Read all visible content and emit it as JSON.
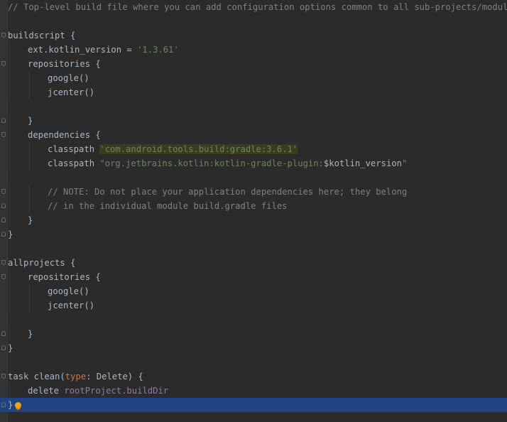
{
  "editor": {
    "language": "gradle",
    "lines": [
      {
        "indent": 0,
        "fold": "",
        "parts": [
          {
            "t": "// Top-level build file where you can add configuration options common to all sub-projects/modules.",
            "c": "c"
          }
        ]
      },
      {
        "indent": 0,
        "fold": "",
        "parts": []
      },
      {
        "indent": 0,
        "fold": "start",
        "parts": [
          {
            "t": "buildscript {",
            "c": ""
          }
        ]
      },
      {
        "indent": 1,
        "fold": "",
        "parts": [
          {
            "t": "ext.kotlin_version = ",
            "c": ""
          },
          {
            "t": "'1.3.61'",
            "c": "s"
          }
        ]
      },
      {
        "indent": 1,
        "fold": "start",
        "parts": [
          {
            "t": "repositories {",
            "c": ""
          }
        ]
      },
      {
        "indent": 2,
        "fold": "",
        "parts": [
          {
            "t": "google()",
            "c": ""
          }
        ]
      },
      {
        "indent": 2,
        "fold": "",
        "parts": [
          {
            "t": "jcenter()",
            "c": ""
          }
        ]
      },
      {
        "indent": 0,
        "fold": "",
        "parts": []
      },
      {
        "indent": 1,
        "fold": "end",
        "parts": [
          {
            "t": "}",
            "c": ""
          }
        ]
      },
      {
        "indent": 1,
        "fold": "start",
        "parts": [
          {
            "t": "dependencies {",
            "c": ""
          }
        ]
      },
      {
        "indent": 2,
        "fold": "",
        "parts": [
          {
            "t": "classpath ",
            "c": ""
          },
          {
            "t": "'com.android.tools.build:gradle:3.6.1'",
            "c": "s hl"
          }
        ]
      },
      {
        "indent": 2,
        "fold": "",
        "parts": [
          {
            "t": "classpath ",
            "c": ""
          },
          {
            "t": "\"org.jetbrains.kotlin:kotlin-gradle-plugin:",
            "c": "s"
          },
          {
            "t": "$kotlin_version",
            "c": ""
          },
          {
            "t": "\"",
            "c": "s"
          }
        ]
      },
      {
        "indent": 0,
        "fold": "",
        "parts": []
      },
      {
        "indent": 2,
        "fold": "start",
        "parts": [
          {
            "t": "// NOTE: Do not place your application dependencies here; they belong",
            "c": "c"
          }
        ]
      },
      {
        "indent": 2,
        "fold": "end",
        "parts": [
          {
            "t": "// in the individual module build.gradle files",
            "c": "c"
          }
        ]
      },
      {
        "indent": 1,
        "fold": "end",
        "parts": [
          {
            "t": "}",
            "c": ""
          }
        ]
      },
      {
        "indent": 0,
        "fold": "end",
        "parts": [
          {
            "t": "}",
            "c": ""
          }
        ]
      },
      {
        "indent": 0,
        "fold": "",
        "parts": []
      },
      {
        "indent": 0,
        "fold": "start",
        "parts": [
          {
            "t": "allprojects {",
            "c": ""
          }
        ]
      },
      {
        "indent": 1,
        "fold": "start",
        "parts": [
          {
            "t": "repositories {",
            "c": ""
          }
        ]
      },
      {
        "indent": 2,
        "fold": "",
        "parts": [
          {
            "t": "google()",
            "c": ""
          }
        ]
      },
      {
        "indent": 2,
        "fold": "",
        "parts": [
          {
            "t": "jcenter()",
            "c": ""
          }
        ]
      },
      {
        "indent": 0,
        "fold": "",
        "parts": []
      },
      {
        "indent": 1,
        "fold": "end",
        "parts": [
          {
            "t": "}",
            "c": ""
          }
        ]
      },
      {
        "indent": 0,
        "fold": "end",
        "parts": [
          {
            "t": "}",
            "c": ""
          }
        ]
      },
      {
        "indent": 0,
        "fold": "",
        "parts": []
      },
      {
        "indent": 0,
        "fold": "start",
        "parts": [
          {
            "t": "task clean(",
            "c": ""
          },
          {
            "t": "type",
            "c": "k"
          },
          {
            "t": ": Delete) {",
            "c": ""
          }
        ]
      },
      {
        "indent": 1,
        "fold": "",
        "parts": [
          {
            "t": "delete ",
            "c": ""
          },
          {
            "t": "rootProject",
            "c": "p"
          },
          {
            "t": ".buildDir",
            "c": "p"
          }
        ]
      },
      {
        "indent": 0,
        "fold": "end",
        "current": true,
        "bulb": "intention-bulb-icon",
        "parts": [
          {
            "t": "}",
            "c": ""
          }
        ]
      }
    ]
  },
  "colors": {
    "background": "#2b2b2b",
    "text": "#a9b7c6",
    "comment": "#808080",
    "string": "#6a8759",
    "keyword": "#cc7832",
    "property": "#9876aa",
    "current_line": "#214283",
    "bulb": "#f0a30a"
  }
}
